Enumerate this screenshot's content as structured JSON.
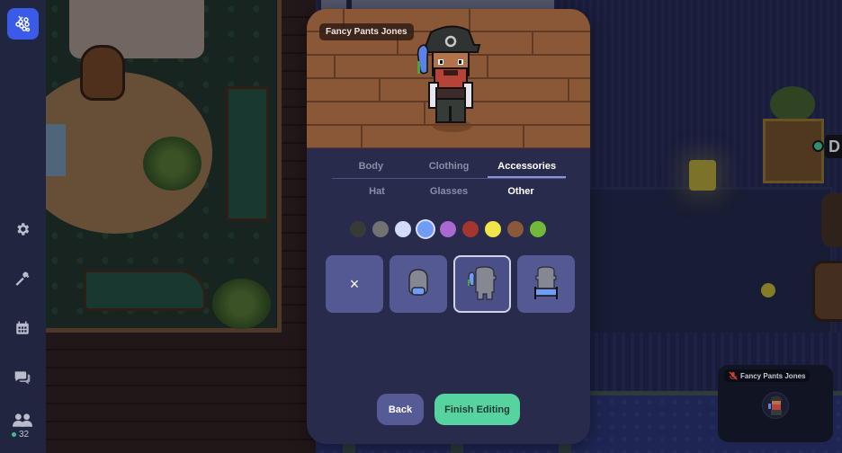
{
  "sidebar": {
    "logo": "app-logo",
    "items": [
      {
        "name": "settings",
        "icon": "gear-icon"
      },
      {
        "name": "build",
        "icon": "hammer-icon"
      },
      {
        "name": "calendar",
        "icon": "calendar-icon"
      },
      {
        "name": "chat",
        "icon": "chat-icon"
      },
      {
        "name": "participants",
        "icon": "people-icon"
      }
    ],
    "online_count": "32",
    "online_color": "#3fbf8f"
  },
  "map": {
    "player_label": "D",
    "player_status_color": "#3fbf8f"
  },
  "editor": {
    "preview": {
      "name_tag": "Fancy Pants Jones"
    },
    "tabs": [
      {
        "label": "Body",
        "active": false
      },
      {
        "label": "Clothing",
        "active": false
      },
      {
        "label": "Accessories",
        "active": true
      }
    ],
    "subtabs": [
      {
        "label": "Hat",
        "active": false
      },
      {
        "label": "Glasses",
        "active": false
      },
      {
        "label": "Other",
        "active": true
      }
    ],
    "colors": [
      {
        "name": "dark-gray",
        "hex": "#373b37",
        "selected": false
      },
      {
        "name": "gray",
        "hex": "#727272",
        "selected": false
      },
      {
        "name": "light-blue",
        "hex": "#d2dcfa",
        "selected": false
      },
      {
        "name": "blue",
        "hex": "#6f9cf5",
        "selected": true
      },
      {
        "name": "purple",
        "hex": "#a86ad0",
        "selected": false
      },
      {
        "name": "red",
        "hex": "#a5352f",
        "selected": false
      },
      {
        "name": "yellow",
        "hex": "#f0e64a",
        "selected": false
      },
      {
        "name": "brown",
        "hex": "#8a583a",
        "selected": false
      },
      {
        "name": "green",
        "hex": "#72b83a",
        "selected": false
      }
    ],
    "options": [
      {
        "name": "none",
        "label": "×",
        "selected": false
      },
      {
        "name": "face-mask",
        "selected": false
      },
      {
        "name": "parrot",
        "selected": true
      },
      {
        "name": "backpack",
        "selected": false
      }
    ],
    "buttons": {
      "back": "Back",
      "finish": "Finish Editing"
    }
  },
  "self_view": {
    "name": "Fancy Pants Jones",
    "mic_icon": "mic-muted-icon"
  }
}
